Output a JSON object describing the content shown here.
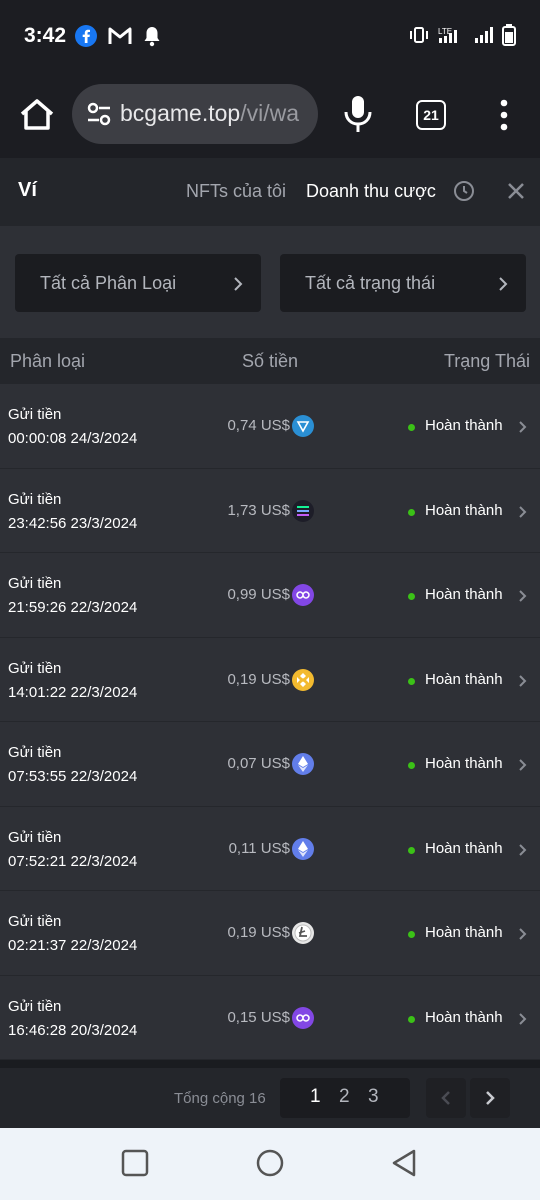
{
  "status_bar": {
    "time": "3:42"
  },
  "browser": {
    "url_host": "bcgame.top",
    "url_path": "/vi/wa",
    "tab_count": "21"
  },
  "wallet": {
    "title": "Ví",
    "tab_nfts": "NFTs của tôi",
    "tab_revenue": "Doanh thu cược"
  },
  "filters": {
    "category": "Tất cả Phân Loại",
    "status": "Tất cả trạng thái"
  },
  "columns": {
    "type": "Phân loại",
    "amount": "Số tiền",
    "status": "Trạng Thái"
  },
  "rows": [
    {
      "type": "Gửi tiền",
      "time": "00:00:08 24/3/2024",
      "amount": "0,74 US$",
      "coin": "tron",
      "status": "Hoàn thành"
    },
    {
      "type": "Gửi tiền",
      "time": "23:42:56 23/3/2024",
      "amount": "1,73 US$",
      "coin": "solana",
      "status": "Hoàn thành"
    },
    {
      "type": "Gửi tiền",
      "time": "21:59:26 22/3/2024",
      "amount": "0,99 US$",
      "coin": "polygon",
      "status": "Hoàn thành"
    },
    {
      "type": "Gửi tiền",
      "time": "14:01:22 22/3/2024",
      "amount": "0,19 US$",
      "coin": "bnb",
      "status": "Hoàn thành"
    },
    {
      "type": "Gửi tiền",
      "time": "07:53:55 22/3/2024",
      "amount": "0,07 US$",
      "coin": "ethereum",
      "status": "Hoàn thành"
    },
    {
      "type": "Gửi tiền",
      "time": "07:52:21 22/3/2024",
      "amount": "0,11 US$",
      "coin": "ethereum",
      "status": "Hoàn thành"
    },
    {
      "type": "Gửi tiền",
      "time": "02:21:37 22/3/2024",
      "amount": "0,19 US$",
      "coin": "litecoin",
      "status": "Hoàn thành"
    },
    {
      "type": "Gửi tiền",
      "time": "16:46:28 20/3/2024",
      "amount": "0,15 US$",
      "coin": "polygon",
      "status": "Hoàn thành"
    }
  ],
  "pagination": {
    "total_label": "Tổng cộng 16",
    "pages": [
      "1",
      "2",
      "3"
    ],
    "current": "1"
  },
  "colors": {
    "status_ok": "#3bc117",
    "tron": "#2a8fd4",
    "solana": "#1d1d28",
    "polygon": "#8247e5",
    "bnb": "#f3ba2f",
    "ethereum": "#627eea",
    "litecoin": "#d9d9d9"
  }
}
